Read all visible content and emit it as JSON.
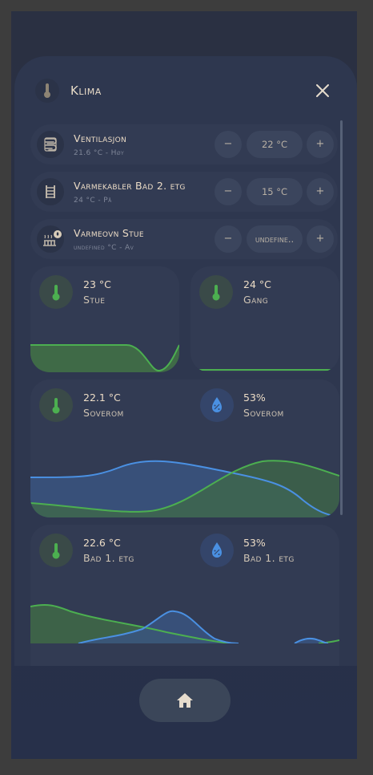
{
  "header": {
    "title": "Klima"
  },
  "climate_rows": [
    {
      "name": "Ventilasjon",
      "status": "21.6 °C - Høy",
      "setpoint": "22 °C"
    },
    {
      "name": "Varmekabler Bad 2. etg",
      "status": "24 °C - På",
      "setpoint": "15 °C"
    },
    {
      "name": "Varmeovn Stue",
      "status": "undefined °C - Av",
      "setpoint": "undefine.."
    }
  ],
  "controls": {
    "minus": "−",
    "plus": "+"
  },
  "sensor_cards": [
    {
      "temp": {
        "value": "23 °C",
        "name": "Stue"
      }
    },
    {
      "temp": {
        "value": "24 °C",
        "name": "Gang"
      }
    },
    {
      "temp": {
        "value": "22.1 °C",
        "name": "Soverom"
      },
      "humidity": {
        "value": "53%",
        "name": "Soverom"
      }
    },
    {
      "temp": {
        "value": "22.6 °C",
        "name": "Bad 1. etg"
      },
      "humidity": {
        "value": "53%",
        "name": "Bad 1. etg"
      }
    }
  ],
  "colors": {
    "temp_line": "#4caf50",
    "humidity_line": "#4a90e2",
    "accent_text": "#ecdcc6"
  },
  "icons": [
    "thermometer-icon",
    "close-icon",
    "ventilation-icon",
    "heating-cable-icon",
    "radiator-flame-icon",
    "humidity-icon",
    "home-icon"
  ]
}
